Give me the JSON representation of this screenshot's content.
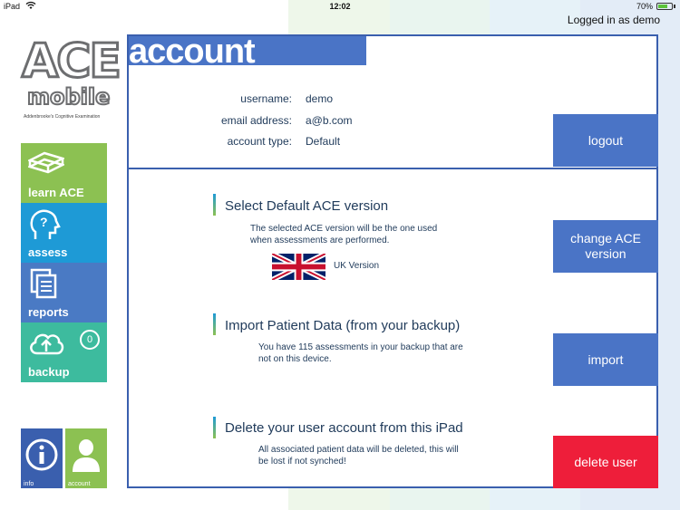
{
  "status_bar": {
    "carrier": "iPad",
    "time": "12:02",
    "battery": "70%",
    "battery_level": 0.7
  },
  "header": {
    "logged_in": "Logged in as demo"
  },
  "logo": {
    "ace": "ACE",
    "mobile": "mobile",
    "subtitle": "Addenbrooke's Cognitive Examination"
  },
  "nav": {
    "learn": "learn ACE",
    "assess": "assess",
    "reports": "reports",
    "backup": "backup",
    "backup_count": "0",
    "info": "info",
    "account": "account"
  },
  "account": {
    "title": "account",
    "username_label": "username:",
    "username": "demo",
    "email_label": "email address:",
    "email": "a@b.com",
    "type_label": "account type:",
    "type": "Default",
    "logout_label": "logout"
  },
  "ace_version": {
    "title": "Select Default ACE version",
    "desc_line1": "The selected ACE version will be the one used",
    "desc_line2": "when assessments are performed.",
    "version": "UK Version",
    "button_line1": "change ACE",
    "button_line2": "version"
  },
  "import": {
    "title": "Import Patient Data (from your backup)",
    "desc_line1": "You have 115 assessments in your backup that are",
    "desc_line2": "not on this device.",
    "button": "import"
  },
  "delete": {
    "title": "Delete your user account from this iPad",
    "desc_line1": "All associated patient data will be deleted, this will",
    "desc_line2": "be lost if not synched!",
    "button": "delete user"
  },
  "colors": {
    "primary_blue": "#4a74c6",
    "danger_red": "#ee1e3a",
    "green": "#8cc152",
    "light_blue": "#1e9ad6",
    "teal": "#3dbb9e"
  }
}
